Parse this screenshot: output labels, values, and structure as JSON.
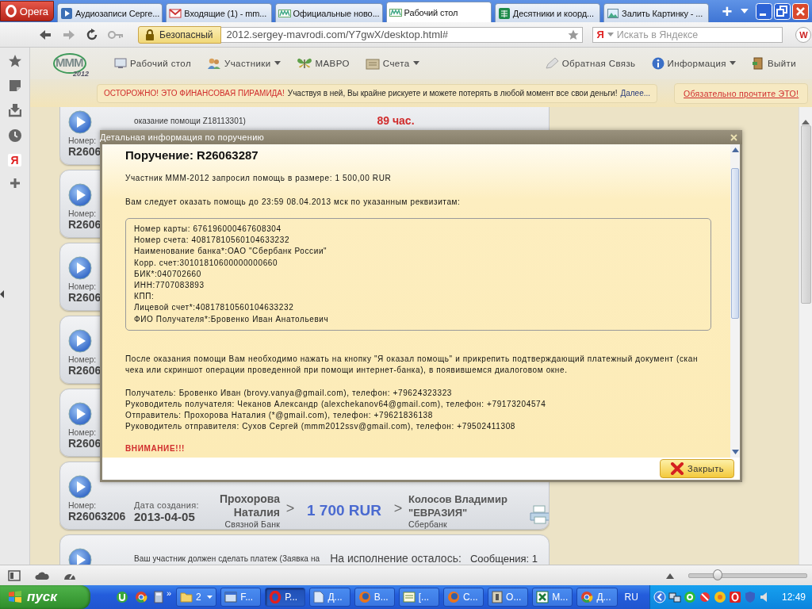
{
  "browser": {
    "menu_button": "Opera",
    "tabs": [
      {
        "kind": "audio",
        "title": "Аудиозаписи Серге...",
        "selected": false
      },
      {
        "kind": "mail",
        "title": "Входящие (1) - mm...",
        "selected": false
      },
      {
        "kind": "site",
        "title": "Официальные ново...",
        "selected": false
      },
      {
        "kind": "site",
        "title": "Рабочий стол",
        "selected": true
      },
      {
        "kind": "sheet",
        "title": "Десятники и коорд...",
        "selected": false
      },
      {
        "kind": "image",
        "title": "Залить Картинку - ...",
        "selected": false
      }
    ],
    "new_tab": "+",
    "security_badge": "Безопасный",
    "url": "2012.sergey-mavrodi.com/Y7gwX/desktop.html#",
    "search": {
      "engine_mark": "Я",
      "placeholder": "Искать в Яндексе"
    },
    "extension_mark": "W"
  },
  "sidebar": {
    "yandex_mark": "Я"
  },
  "site": {
    "logo": {
      "mark": "МММ",
      "year": "2012"
    },
    "nav": [
      {
        "kind": "desk",
        "label": "Рабочий стол",
        "dropdown": false
      },
      {
        "kind": "people",
        "label": "Участники",
        "dropdown": true
      },
      {
        "kind": "butterfly",
        "label": "МАВРО",
        "dropdown": false
      },
      {
        "kind": "accounts",
        "label": "Счета",
        "dropdown": true
      }
    ],
    "nav_right": [
      {
        "kind": "feedback",
        "label": "Обратная Связь",
        "dropdown": false
      },
      {
        "kind": "info",
        "label": "Информация",
        "dropdown": true
      },
      {
        "kind": "exit",
        "label": "Выйти",
        "dropdown": false
      }
    ],
    "warning": {
      "alert": "ОСТОРОЖНО! ЭТО ФИНАНСОВАЯ ПИРАМИДА!",
      "text": "Участвуя в ней, Вы крайне рискуете и можете потерять в любой момент все свои деньги!",
      "more": "Далее..."
    },
    "must_read": "Обязательно прочтите ЭТО!",
    "cards": [
      {
        "message": "оказание помощи Z18113301)",
        "hours": "89 час.",
        "number_label": "Номер:",
        "number": "R2606"
      },
      {
        "number_label": "Номер:",
        "number": "R2606"
      },
      {
        "number_label": "Номер:",
        "number": "R2606"
      },
      {
        "number_label": "Номер:",
        "number": "R2606"
      },
      {
        "number_label": "Номер:",
        "number": "R2606"
      },
      {
        "number_label": "Номер:",
        "number": "R26063206",
        "date_label": "Дата создания:",
        "date": "2013-04-05",
        "sender": "Прохорова Наталия",
        "sender_bank": "Связной Банк",
        "separators": [
          ">",
          ">"
        ],
        "amount": "1 700 RUR",
        "receiver": "Колосов Владимир \"ЕВРАЗИЯ\"",
        "receiver_bank": "Сбербанк"
      },
      {
        "message": "Ваш участник должен сделать платеж (Заявка на",
        "remaining": "На исполнение осталось:",
        "messages": "Сообщения: 1"
      }
    ]
  },
  "dialog": {
    "title": "Детальная информация по поручению",
    "heading": "Поручение: R26063287",
    "intro": [
      "Участник МММ-2012 запросил помощь в размере: 1 500,00 RUR",
      "Вам следует оказать помощь до 23:59 08.04.2013 мск по указанным реквизитам:"
    ],
    "details": [
      "Номер карты: 676196000467608304",
      "Номер счета: 40817810560104633232",
      "Наименование банка*:ОАО \"Сбербанк России\"",
      "Корр. счет:30101810600000000660",
      "БИК*:040702660",
      "ИНН:7707083893",
      "КПП:",
      "Лицевой счет*:40817810560104633232",
      "ФИО Получателя*:Бровенко Иван Анатольевич"
    ],
    "instructions": "После оказания помощи Вам необходимо нажать на кнопку \"Я оказал помощь\" и прикрепить подтверждающий платежный документ (скан чека или скриншот операции проведенной при помощи интернет-банка), в появившемся диалоговом окне.",
    "contacts": [
      "Получатель: Бровенко Иван (brovy.vanya@gmail.com), телефон: +79624323323",
      "Руководитель получателя: Чеканов Александр (alexchekanov64@gmail.com), телефон: +79173204574",
      "Отправитель: Прохорова Наталия (*@gmail.com), телефон: +79621836138",
      "Руководитель отправителя: Сухов Сергей (mmm2012ssv@gmail.com), телефон: +79502411308"
    ],
    "attention": "ВНИМАНИЕ!!!",
    "close_button": "Закрыть"
  },
  "status_bar": {
    "zoom_slider": {
      "level": 0.24
    }
  },
  "taskbar": {
    "start": "пуск",
    "more": "»",
    "items": [
      {
        "kind": "folder",
        "label": "2",
        "selected": false
      },
      {
        "kind": "window",
        "label": "F...",
        "selected": false
      },
      {
        "kind": "opera",
        "label": "Р...",
        "selected": true
      },
      {
        "kind": "doc",
        "label": "Д...",
        "selected": false
      },
      {
        "kind": "firefox",
        "label": "В...",
        "selected": false
      },
      {
        "kind": "notepad",
        "label": "[...",
        "selected": false
      },
      {
        "kind": "firefox",
        "label": "С...",
        "selected": false
      },
      {
        "kind": "book",
        "label": "О...",
        "selected": false
      },
      {
        "kind": "excel",
        "label": "М...",
        "selected": false
      },
      {
        "kind": "chrome",
        "label": "Д...",
        "selected": false
      }
    ],
    "language": "RU",
    "clock": "12:49"
  }
}
